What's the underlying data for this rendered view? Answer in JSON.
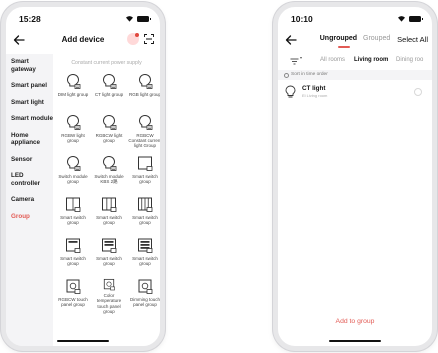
{
  "left": {
    "time": "15:28",
    "title": "Add device",
    "sidebar": [
      {
        "label": "Smart gateway",
        "active": false
      },
      {
        "label": "Smart panel",
        "active": false
      },
      {
        "label": "Smart light",
        "active": false
      },
      {
        "label": "Smart module",
        "active": false
      },
      {
        "label": "Home appliance",
        "active": false
      },
      {
        "label": "Sensor",
        "active": false
      },
      {
        "label": "LED controller",
        "active": false
      },
      {
        "label": "Camera",
        "active": false
      },
      {
        "label": "Group",
        "active": true
      }
    ],
    "section_title": "Constant current power supply",
    "items": [
      {
        "label": "DIM light group",
        "icon": "light-bulb-icon"
      },
      {
        "label": "CT light group",
        "icon": "light-bulb-icon"
      },
      {
        "label": "RGB light group",
        "icon": "light-bulb-icon"
      },
      {
        "label": "RGBW light group",
        "icon": "light-bulb-icon"
      },
      {
        "label": "RGBCW light group",
        "icon": "light-bulb-icon"
      },
      {
        "label": "RGBCW Constant current light Group",
        "icon": "light-bulb-icon"
      },
      {
        "label": "Switch module group",
        "icon": "light-bulb-icon"
      },
      {
        "label": "Switch module KBS 2路",
        "icon": "light-bulb-icon"
      },
      {
        "label": "Smart switch group",
        "icon": "switch-1gang-icon"
      },
      {
        "label": "Smart switch group",
        "icon": "switch-2gang-icon"
      },
      {
        "label": "Smart switch group",
        "icon": "switch-3gang-icon"
      },
      {
        "label": "Smart switch group",
        "icon": "switch-4gang-icon"
      },
      {
        "label": "Smart switch group",
        "icon": "switch-1gang-alt-icon"
      },
      {
        "label": "Smart switch group",
        "icon": "switch-2gang-alt-icon"
      },
      {
        "label": "Smart switch group",
        "icon": "switch-3gang-alt-icon"
      },
      {
        "label": "RGBCW touch panel group",
        "icon": "touch-panel-icon"
      },
      {
        "label": "Color temperature touch panel group",
        "icon": "touch-panel-icon"
      },
      {
        "label": "Dimming touch panel group",
        "icon": "touch-panel-icon"
      }
    ]
  },
  "right": {
    "time": "10:10",
    "tabs": {
      "ungrouped": "Ungrouped",
      "grouped": "Grouped"
    },
    "select_all": "Select All",
    "rooms": {
      "all": "All rooms",
      "living": "Living room",
      "dining": "Dining roo"
    },
    "sort_label": "Sort in time order",
    "device": {
      "name": "CT light",
      "room": "El Living room"
    },
    "add_button": "Add to group"
  },
  "colors": {
    "accent": "#e25b55",
    "sidebar_bg": "#f4f4f6"
  }
}
